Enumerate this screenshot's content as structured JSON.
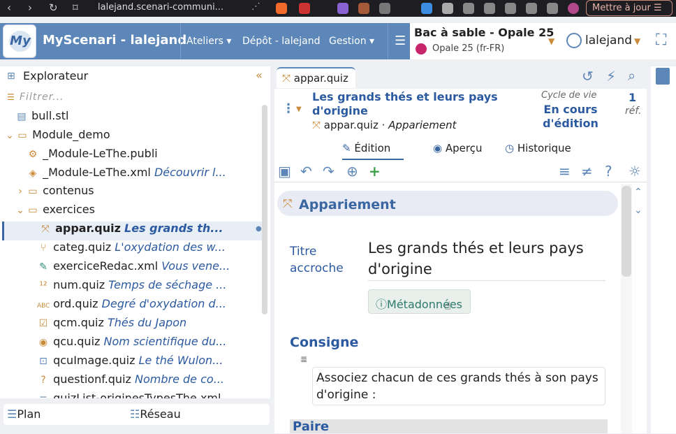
{
  "browser": {
    "url": "lalejand.scenari-communi...",
    "update_label": "Mettre à jour"
  },
  "app": {
    "title": "MyScenari - lalejand",
    "menu": [
      "Ateliers",
      "Dépôt - lalejand",
      "Gestion"
    ],
    "workspace_title": "Bac à sable - Opale 25",
    "workspace_model": "Opale 25 (fr-FR)",
    "user": "lalejand"
  },
  "explorer": {
    "title": "Explorateur",
    "filter_placeholder": "Filtrer...",
    "items": [
      {
        "name": "bull.stl",
        "desc": ""
      },
      {
        "name": "Module_demo",
        "desc": ""
      },
      {
        "name": "_Module-LeThe.publi",
        "desc": ""
      },
      {
        "name": "_Module-LeThe.xml",
        "desc": "Découvrir l..."
      },
      {
        "name": "contenus",
        "desc": ""
      },
      {
        "name": "exercices",
        "desc": ""
      },
      {
        "name": "appar.quiz",
        "desc": "Les grands th..."
      },
      {
        "name": "categ.quiz",
        "desc": "L'oxydation des w..."
      },
      {
        "name": "exerciceRedac.xml",
        "desc": "Vous vene..."
      },
      {
        "name": "num.quiz",
        "desc": "Temps de séchage ..."
      },
      {
        "name": "ord.quiz",
        "desc": "Degré d'oxydation d..."
      },
      {
        "name": "qcm.quiz",
        "desc": "Thés du Japon"
      },
      {
        "name": "qcu.quiz",
        "desc": "Nom scientifique du..."
      },
      {
        "name": "qcuImage.quiz",
        "desc": "Le thé Wulon..."
      },
      {
        "name": "questionf.quiz",
        "desc": "Nombre de co..."
      },
      {
        "name": "quizList-originesTypesThe.xml",
        "desc": ""
      }
    ],
    "bottom_tabs": [
      "Plan",
      "Réseau"
    ]
  },
  "editor": {
    "tab": "appar.quiz",
    "doc_title": "Les grands thés et leurs pays d'origine",
    "doc_file": "appar.quiz",
    "doc_type": "Appariement",
    "cycle_label": "Cycle de vie",
    "cycle_value": "En cours d'édition",
    "ref_count": "1",
    "ref_label": "réf.",
    "subtabs": [
      "Édition",
      "Aperçu",
      "Historique"
    ],
    "section": "Appariement",
    "titre_label": "Titre accroche",
    "titre_value": "Les grands thés et leurs pays d'origine",
    "meta_button": "Métadonnées",
    "consigne_label": "Consigne",
    "consigne_text": "Associez chacun de ces grands thés à son pays d'origine :",
    "paire_label": "Paire"
  }
}
